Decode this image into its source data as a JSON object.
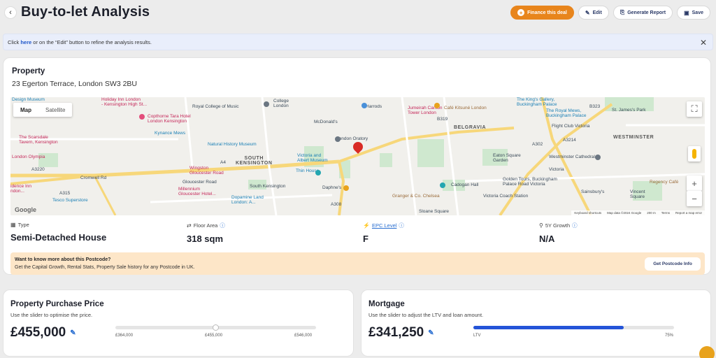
{
  "header": {
    "title": "Buy-to-let Analysis",
    "back_icon": "chevron-left-icon",
    "buttons": {
      "finance": "Finance this deal",
      "edit": "Edit",
      "report": "Generate Report",
      "save": "Save"
    }
  },
  "info_banner": {
    "prefix": "Click ",
    "link": "here",
    "suffix": " or on the “Edit” button to refine the analysis results."
  },
  "property": {
    "heading": "Property",
    "address": "23 Egerton Terrace, London SW3 2BU",
    "map": {
      "type_map": "Map",
      "type_satellite": "Satellite",
      "labels": {
        "design_museum": "Design Museum",
        "holiday_inn": "Holiday Inn London\n- Kensington High St...",
        "royal_college": "Royal College of Music",
        "college": "College\nLondon",
        "harrods": "Harrods",
        "kings_gallery": "The King's Gallery,\nBuckingham Palace",
        "cafe_kitsune": "Café Kitsuné London",
        "royal_mews": "The Royal Mews,\nBuckingham Palace",
        "st_james": "St. James's Park",
        "copthorne": "Copthorne Tara Hotel\nLondon Kensington",
        "kynance": "Kynance Mews",
        "mcdonalds": "McDonald's",
        "jumeirah": "Jumeirah Carlton\nTower London",
        "belgravia": "BELGRAVIA",
        "flight_club": "Flight Club Victoria",
        "westminster": "WESTMINSTER",
        "scarsdale": "The Scarsdale\nTavern, Kensington",
        "nhm": "Natural History Museum",
        "oratory": "London Oratory",
        "london_olympia": "London Olympia",
        "va": "Victoria and\nAlbert Museum",
        "eaton_square": "Eaton Square\nGarden",
        "westminster_cathedral": "Westminster Cathedral",
        "wingston": "Wingston\nGloucester Road",
        "south_kensington": "SOUTH\nKENSINGTON",
        "thin_house": "Thin House",
        "victoria": "Victoria",
        "gloucester_road": "Gloucester Road",
        "millennium": "Millennium\nGloucester Hotel...",
        "south_kensington_station": "South Kensington",
        "daphnes": "Daphne's",
        "cadogan_hall": "Cadogan Hall",
        "golden_tours": "Golden Tours, Buckingham\nPalace Road Victoria",
        "regency_cafe": "Regency Café",
        "residence_inn": "idence Inn\nndon...",
        "tesco": "Tesco Superstore",
        "dopamine": "Dopamine Land\nLondon: A...",
        "granger": "Granger & Co. Chelsea",
        "victoria_coach": "Victoria Coach Station",
        "sainsburys": "Sainsbury's",
        "vincent_square": "Vincent\nSquare",
        "sloane_square": "Sloane Square",
        "cromwell_rd": "Cromwell Rd",
        "a4": "A4",
        "a3220": "A3220",
        "a315": "A315",
        "a302": "A302",
        "a3214": "A3214",
        "b323": "B323",
        "b319": "B319",
        "a308": "A308"
      },
      "attribution": {
        "shortcuts": "Keyboard shortcuts",
        "data": "Map data ©2024 Google",
        "scale": "200 m",
        "terms": "Terms",
        "report": "Report a map error"
      },
      "google": "Google"
    },
    "stats": {
      "type_label": "Type",
      "type_value": "Semi-Detached House",
      "area_label": "Floor Area",
      "area_value": "318 sqm",
      "epc_label": "EPC Level",
      "epc_value": "F",
      "growth_label": "5Y Growth",
      "growth_value": "N/A"
    },
    "postcode": {
      "title": "Want to know more about this Postcode?",
      "subtitle": "Get the Capital Growth, Rental Stats, Property Sale history for any Postcode in UK.",
      "button": "Get Postcode Info"
    }
  },
  "purchase": {
    "heading": "Property Purchase Price",
    "subtitle": "Use the slider to optimise the price.",
    "value": "£455,000",
    "min": "£364,000",
    "mid": "£455,000",
    "max": "£546,000",
    "slider_fraction": 0.5
  },
  "mortgage": {
    "heading": "Mortgage",
    "subtitle": "Use the slider to adjust the LTV and loan amount.",
    "value": "£341,250",
    "ltv_label": "LTV",
    "ltv_value": "75%",
    "slider_fraction": 0.75
  },
  "colors": {
    "accent_orange": "#e8851c",
    "accent_blue": "#2454d8",
    "banner_bg": "#e9eefb",
    "postcode_bg": "#fde6c8"
  }
}
